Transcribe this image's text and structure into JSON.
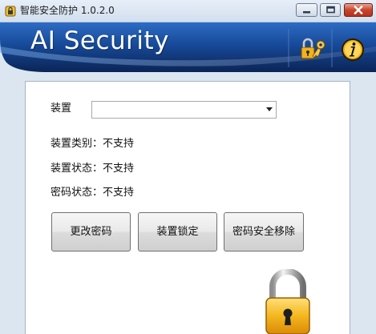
{
  "window": {
    "title": "智能安全防护 1.0.2.0"
  },
  "banner": {
    "title": "AI Security",
    "key_icon": "key-icon",
    "info_icon": "info-icon"
  },
  "form": {
    "device_label": "装置",
    "device_select_value": "",
    "device_type_label": "装置类别：",
    "device_type_value": "不支持",
    "device_status_label": "装置状态：",
    "device_status_value": "不支持",
    "password_status_label": "密码状态：",
    "password_status_value": "不支持"
  },
  "buttons": {
    "change_password": "更改密码",
    "lock_device": "装置锁定",
    "remove_password": "密码安全移除"
  },
  "decor": {
    "lock_icon": "padlock-icon"
  },
  "colors": {
    "banner_dark": "#0d2a5c",
    "banner_blue": "#1c56a8",
    "lock_gold": "#f2b21b"
  }
}
